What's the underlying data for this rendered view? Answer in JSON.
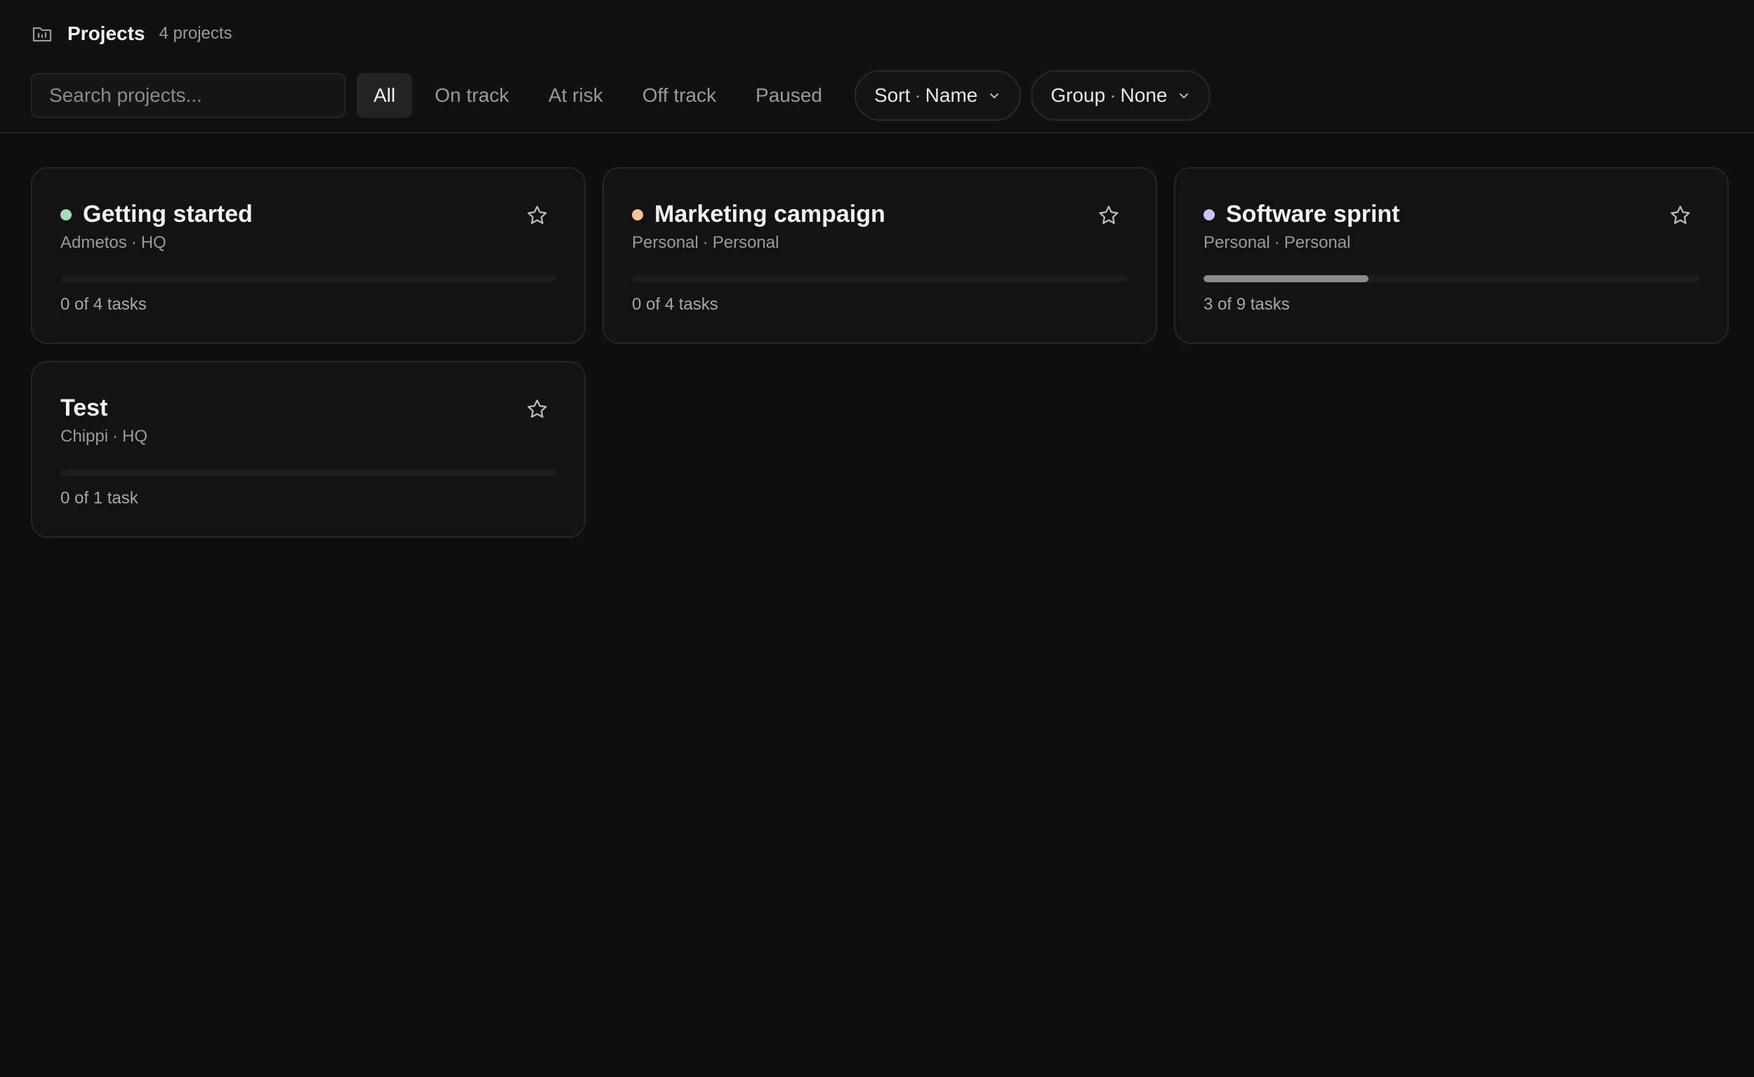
{
  "header": {
    "title": "Projects",
    "count_label": "4 projects"
  },
  "search": {
    "placeholder": "Search projects..."
  },
  "filters": [
    "All",
    "On track",
    "At risk",
    "Off track",
    "Paused"
  ],
  "active_filter": "All",
  "sort": {
    "label": "Sort",
    "value": "Name"
  },
  "group": {
    "label": "Group",
    "value": "None"
  },
  "separator": "·",
  "projects": [
    {
      "name": "Getting started",
      "owner": "Admetos",
      "team": "HQ",
      "status_color": "#a8dcb8",
      "progress": 0.0,
      "tasks_label": "0 of 4 tasks",
      "starred": false
    },
    {
      "name": "Marketing campaign",
      "owner": "Personal",
      "team": "Personal",
      "status_color": "#f2c49b",
      "progress": 0.0,
      "tasks_label": "0 of 4 tasks",
      "starred": false
    },
    {
      "name": "Software sprint",
      "owner": "Personal",
      "team": "Personal",
      "status_color": "#c8c3f4",
      "progress": 0.3333,
      "tasks_label": "3 of 9 tasks",
      "starred": false
    },
    {
      "name": "Test",
      "owner": "Chippi",
      "team": "HQ",
      "status_color": null,
      "progress": 0.0,
      "tasks_label": "0 of 1 task",
      "starred": false
    }
  ],
  "icons": {
    "header": "folder-icon",
    "star": "star-icon",
    "dropdown": "chevron-down-icon"
  }
}
